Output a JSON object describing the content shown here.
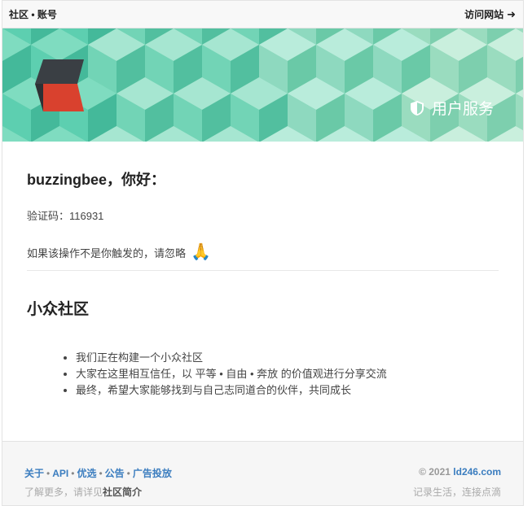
{
  "topbar": {
    "breadcrumb": "社区 • 账号",
    "visit_label": "访问网站",
    "visit_arrow": "➜"
  },
  "banner": {
    "service_label": "用户服务"
  },
  "message": {
    "greeting": "buzzingbee，你好：",
    "code_text": "验证码：116931",
    "ignore_text": "如果该操作不是你触发的，请忽略",
    "ignore_emoji": "🙏"
  },
  "community": {
    "title": "小众社区",
    "bullets": [
      "我们正在构建一个小众社区",
      "大家在这里相互信任，以 平等 • 自由 • 奔放 的价值观进行分享交流",
      "最终，希望大家能够找到与自己志同道合的伙伴，共同成长"
    ]
  },
  "footer": {
    "links": [
      "关于",
      "API",
      "优选",
      "公告",
      "广告投放"
    ],
    "link_separator": "•",
    "copyright_prefix": "© 2021 ",
    "domain": "ld246.com",
    "more_prefix": "了解更多，请详见",
    "more_link": "社区简介",
    "slogan": "记录生活，连接点滴"
  },
  "colors": {
    "accent": "#3b7dbf",
    "banner_green": "#7fd4b3",
    "logo_red": "#d9412e",
    "logo_dark": "#3a3f44"
  }
}
